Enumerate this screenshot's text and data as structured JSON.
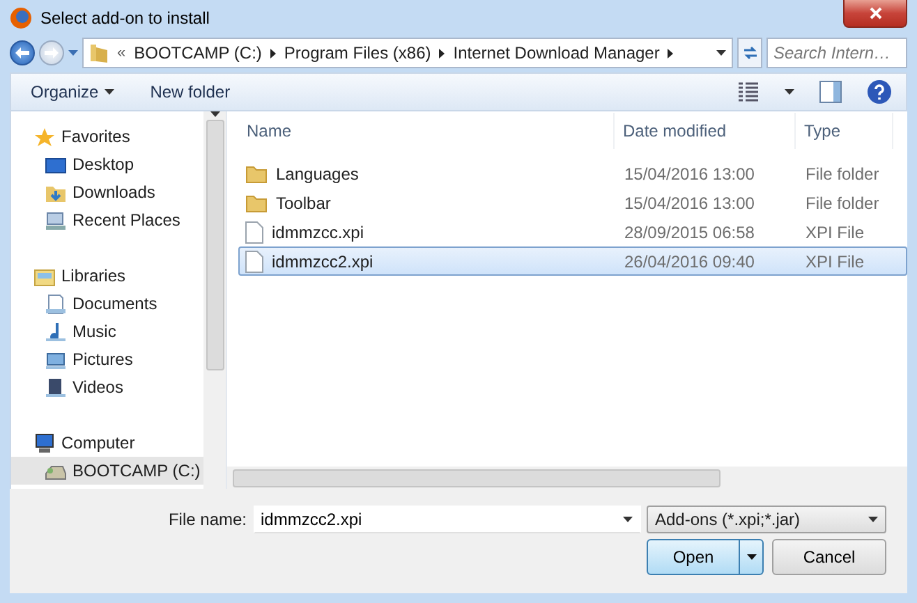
{
  "window": {
    "title": "Select add-on to install"
  },
  "address_bar": {
    "overflow": "«",
    "segments": [
      "BOOTCAMP (C:)",
      "Program Files (x86)",
      "Internet Download Manager"
    ]
  },
  "search": {
    "placeholder": "Search Intern…"
  },
  "toolbar": {
    "organize": "Organize",
    "new_folder": "New folder"
  },
  "sidebar": {
    "groups": [
      {
        "label": "Favorites",
        "kind": "favorites",
        "children": [
          {
            "label": "Desktop",
            "kind": "desktop",
            "selected": false
          },
          {
            "label": "Downloads",
            "kind": "downloads",
            "selected": false
          },
          {
            "label": "Recent Places",
            "kind": "recent",
            "selected": false
          }
        ]
      },
      {
        "label": "Libraries",
        "kind": "libraries",
        "children": [
          {
            "label": "Documents",
            "kind": "documents",
            "selected": false
          },
          {
            "label": "Music",
            "kind": "music",
            "selected": false
          },
          {
            "label": "Pictures",
            "kind": "pictures",
            "selected": false
          },
          {
            "label": "Videos",
            "kind": "videos",
            "selected": false
          }
        ]
      },
      {
        "label": "Computer",
        "kind": "computer",
        "children": [
          {
            "label": "BOOTCAMP (C:)",
            "kind": "drive",
            "selected": true
          }
        ]
      }
    ]
  },
  "file_list": {
    "columns": [
      "Name",
      "Date modified",
      "Type"
    ],
    "rows": [
      {
        "name": "Languages",
        "date": "15/04/2016 13:00",
        "type": "File folder",
        "kind": "folder",
        "selected": false
      },
      {
        "name": "Toolbar",
        "date": "15/04/2016 13:00",
        "type": "File folder",
        "kind": "folder",
        "selected": false
      },
      {
        "name": "idmmzcc.xpi",
        "date": "28/09/2015 06:58",
        "type": "XPI File",
        "kind": "file",
        "selected": false
      },
      {
        "name": "idmmzcc2.xpi",
        "date": "26/04/2016 09:40",
        "type": "XPI File",
        "kind": "file",
        "selected": true
      }
    ]
  },
  "file_name": {
    "label": "File name:",
    "value": "idmmzcc2.xpi"
  },
  "file_type": {
    "value": "Add-ons (*.xpi;*.jar)"
  },
  "buttons": {
    "open": "Open",
    "cancel": "Cancel"
  }
}
